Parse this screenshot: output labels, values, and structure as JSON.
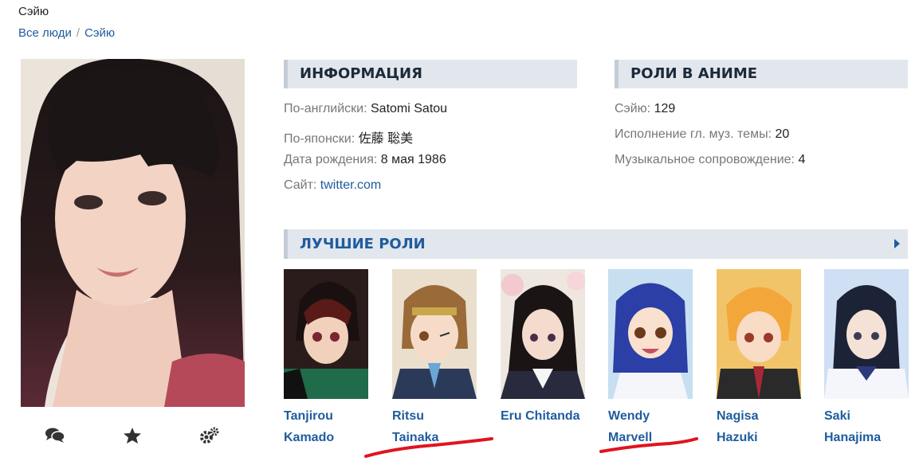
{
  "page": {
    "title": "Сэйю",
    "breadcrumb": [
      "Все люди",
      "Сэйю"
    ],
    "breadcrumb_separator": "/"
  },
  "actions": [
    {
      "icon": "comments-icon"
    },
    {
      "icon": "star-icon"
    },
    {
      "icon": "gears-icon"
    }
  ],
  "info": {
    "heading": "ИНФОРМАЦИЯ",
    "rows": [
      {
        "label": "По-английски:",
        "value": "Satomi Satou"
      },
      {
        "label": "По-японски:",
        "value": "佐藤 聡美"
      },
      {
        "label": "Дата рождения:",
        "value": "8 мая 1986"
      },
      {
        "label": "Сайт:",
        "value": "twitter.com"
      }
    ]
  },
  "anime_roles": {
    "heading": "РОЛИ В АНИМЕ",
    "rows": [
      {
        "label": "Сэйю:",
        "value": "129"
      },
      {
        "label": "Исполнение гл. муз. темы:",
        "value": "20"
      },
      {
        "label": "Музыкальное сопровождение:",
        "value": "4"
      }
    ]
  },
  "best_roles": {
    "heading": "ЛУЧШИЕ РОЛИ",
    "items": [
      {
        "first": "Tanjirou",
        "last": "Kamado"
      },
      {
        "first": "Ritsu",
        "last": "Tainaka"
      },
      {
        "first": "Eru Chitanda",
        "last": ""
      },
      {
        "first": "Wendy",
        "last": "Marvell"
      },
      {
        "first": "Nagisa",
        "last": "Hazuki"
      },
      {
        "first": "Saki",
        "last": "Hanajima"
      }
    ]
  },
  "colors": {
    "link": "#1f5c9e",
    "header_bg": "#e2e7ed",
    "annotation": "#e0141e"
  }
}
